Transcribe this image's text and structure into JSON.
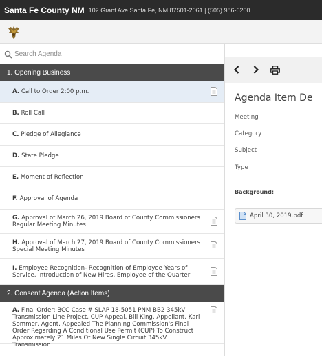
{
  "header": {
    "org_name": "Santa Fe County NM",
    "address": "102 Grant Ave Santa Fe, NM 87501-2061 | (505) 986-6200"
  },
  "logo_icon": "county-seal-icon",
  "sidebar": {
    "search_placeholder": "Search Agenda",
    "sections": [
      {
        "title": "1. Opening Business",
        "items": [
          {
            "letter": "A.",
            "text": "Call to Order 2:00 p.m.",
            "has_doc": true,
            "selected": true
          },
          {
            "letter": "B.",
            "text": "Roll Call",
            "has_doc": false
          },
          {
            "letter": "C.",
            "text": "Pledge of Allegiance",
            "has_doc": false
          },
          {
            "letter": "D.",
            "text": "State Pledge",
            "has_doc": false
          },
          {
            "letter": "E.",
            "text": "Moment of Reflection",
            "has_doc": false
          },
          {
            "letter": "F.",
            "text": "Approval of Agenda",
            "has_doc": false
          },
          {
            "letter": "G.",
            "text": "Approval of March 26, 2019 Board of County Commissioners Regular Meeting Minutes",
            "has_doc": true
          },
          {
            "letter": "H.",
            "text": "Approval of March 27, 2019 Board of County Commissioners Special Meeting Minutes",
            "has_doc": true
          },
          {
            "letter": "I.",
            "text": "Employee Recognition- Recognition of Employee Years of Service, Introduction of New Hires, Employee of the Quarter",
            "has_doc": true
          }
        ]
      },
      {
        "title": "2. Consent Agenda (Action Items)",
        "items": [
          {
            "letter": "A.",
            "text": "Final Order: BCC Case # SLAP 18-5051 PNM BB2 345kV Transmission Line Project, CUP Appeal. Bill King, Appellant, Karl Sommer, Agent, Appealed The Planning Commission's Final Order Regarding A Conditional Use Permit (CUP) To Construct Approximately 21 Miles Of New Single Circuit 345kV Transmission",
            "has_doc": true
          }
        ]
      }
    ]
  },
  "main": {
    "title": "Agenda Item De",
    "fields": [
      "Meeting",
      "Category",
      "Subject",
      "Type"
    ],
    "background_label": "Background:",
    "attachment": "April 30, 2019.pdf",
    "attachment_icon": "pdf-file-icon",
    "nav": {
      "prev_icon": "chevron-left-icon",
      "next_icon": "chevron-right-icon",
      "print_icon": "print-icon"
    }
  }
}
